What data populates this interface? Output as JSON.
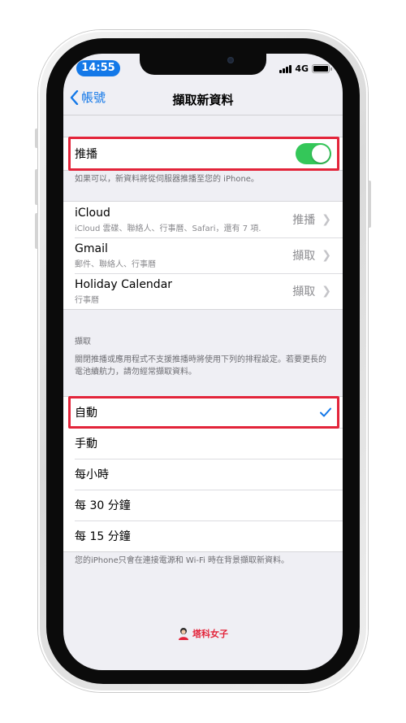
{
  "status_bar": {
    "time": "14:55",
    "network": "4G"
  },
  "nav": {
    "back_label": "帳號",
    "title": "擷取新資料"
  },
  "push": {
    "label": "推播",
    "enabled": true,
    "footnote": "如果可以，新資料將從伺服器推播至您的 iPhone。"
  },
  "accounts": [
    {
      "name": "iCloud",
      "detail": "iCloud 雲碟、聯絡人、行事曆、Safari，還有 7 項…",
      "mode": "推播"
    },
    {
      "name": "Gmail",
      "detail": "郵件、聯絡人、行事曆",
      "mode": "擷取"
    },
    {
      "name": "Holiday Calendar",
      "detail": "行事曆",
      "mode": "擷取"
    }
  ],
  "fetch": {
    "header": "擷取",
    "description": "關閉推播或應用程式不支援推播時將使用下列的排程設定。若要更長的電池續航力，請勿經常擷取資料。",
    "options": [
      "自動",
      "手動",
      "每小時",
      "每 30 分鐘",
      "每 15 分鐘"
    ],
    "selected": "自動",
    "footnote": "您的iPhone只會在連接電源和 Wi-Fi 時在背景擷取新資料。"
  },
  "watermark": {
    "text": "塔科女子"
  },
  "colors": {
    "accent": "#1378e8",
    "toggle_on": "#34c759",
    "highlight": "#e3243a"
  }
}
